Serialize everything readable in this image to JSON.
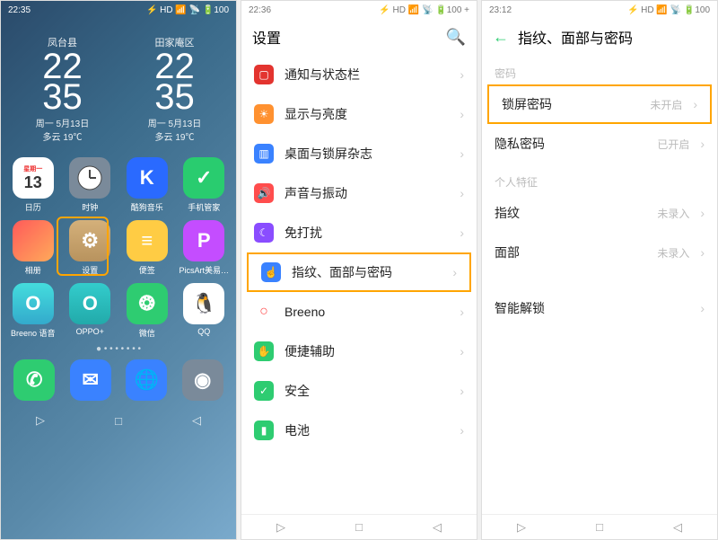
{
  "phone1": {
    "status_time": "22:35",
    "status_right": "⚡ HD  📶 📡 🔋100",
    "widgets": [
      {
        "loc": "凤台县",
        "t1": "22",
        "t2": "35",
        "date": "周一 5月13日",
        "wx": "多云 19℃"
      },
      {
        "loc": "田家庵区",
        "t1": "22",
        "t2": "35",
        "date": "周一 5月13日",
        "wx": "多云 19℃"
      }
    ],
    "apps": [
      {
        "id": "calendar",
        "label": "日历",
        "weekday": "星期一",
        "day": "13"
      },
      {
        "id": "clock",
        "label": "时钟"
      },
      {
        "id": "kugou",
        "label": "酷狗音乐",
        "glyph": "K"
      },
      {
        "id": "guard",
        "label": "手机管家",
        "glyph": "✓"
      },
      {
        "id": "gallery",
        "label": "相册",
        "glyph": ""
      },
      {
        "id": "settings",
        "label": "设置",
        "glyph": "⚙"
      },
      {
        "id": "notes",
        "label": "便签",
        "glyph": "≡"
      },
      {
        "id": "picsart",
        "label": "PicsArt美易…",
        "glyph": "P"
      },
      {
        "id": "breeno",
        "label": "Breeno 语音",
        "glyph": "O"
      },
      {
        "id": "oppo",
        "label": "OPPO+",
        "glyph": "O"
      },
      {
        "id": "wechat",
        "label": "微信",
        "glyph": "❂"
      },
      {
        "id": "qq",
        "label": "QQ",
        "glyph": "🐧"
      }
    ],
    "dots": "● • • • • • • •",
    "dock": [
      {
        "id": "phone",
        "glyph": "✆"
      },
      {
        "id": "msg",
        "glyph": "✉"
      },
      {
        "id": "browser",
        "glyph": "🌐"
      },
      {
        "id": "camera",
        "glyph": "◉"
      }
    ]
  },
  "phone2": {
    "status_time": "22:36",
    "status_right": "⚡ HD  📶 📡 🔋100 +",
    "title": "设置",
    "rows": [
      {
        "icon_cls": "c-red",
        "glyph": "▢",
        "label": "通知与状态栏"
      },
      {
        "icon_cls": "c-o",
        "glyph": "☀",
        "label": "显示与亮度"
      },
      {
        "icon_cls": "c-b",
        "glyph": "▥",
        "label": "桌面与锁屏杂志"
      },
      {
        "icon_cls": "c-r",
        "glyph": "🔊",
        "label": "声音与振动"
      },
      {
        "icon_cls": "c-p",
        "glyph": "☾",
        "label": "免打扰"
      },
      {
        "icon_cls": "c-b",
        "glyph": "☝",
        "label": "指纹、面部与密码",
        "hl": true
      },
      {
        "icon_cls": "",
        "glyph": "○",
        "label": "Breeno",
        "plain": true
      },
      {
        "icon_cls": "c-g",
        "glyph": "✋",
        "label": "便捷辅助"
      },
      {
        "icon_cls": "c-g",
        "glyph": "✓",
        "label": "安全"
      },
      {
        "icon_cls": "c-g",
        "glyph": "▮",
        "label": "电池"
      }
    ]
  },
  "phone3": {
    "status_time": "23:12",
    "status_right": "⚡ HD  📶 📡 🔋100",
    "title": "指纹、面部与密码",
    "sect1": "密码",
    "rows1": [
      {
        "label": "锁屏密码",
        "val": "未开启",
        "hl": true
      },
      {
        "label": "隐私密码",
        "val": "已开启"
      }
    ],
    "sect2": "个人特征",
    "rows2": [
      {
        "label": "指纹",
        "val": "未录入"
      },
      {
        "label": "面部",
        "val": "未录入"
      }
    ],
    "rows3": [
      {
        "label": "智能解锁",
        "val": ""
      }
    ]
  },
  "nav": {
    "back": "◁",
    "home": "□",
    "recent": "◁"
  }
}
